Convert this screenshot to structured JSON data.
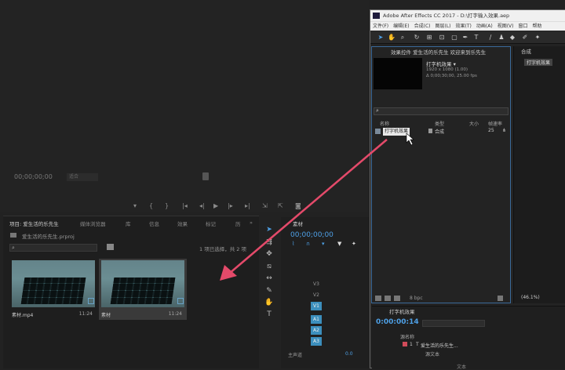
{
  "premiere": {
    "timecode": "00;00;00;00",
    "fit": "适合",
    "panel_tabs": [
      "项目: 爱生活的乐先生",
      "媒体浏览器",
      "库",
      "信息",
      "效果",
      "标记",
      "历"
    ],
    "project_file": "爱生活的乐先生.prproj",
    "selection": "1 项已选择，共 2 项",
    "clips": [
      {
        "name": "素材.mp4",
        "duration": "11:24"
      },
      {
        "name": "素材",
        "duration": "11:24"
      }
    ],
    "timeline_title": "素材",
    "timeline_time": "00;00;00;00",
    "tracks": [
      "V3",
      "V2",
      "V1",
      "A1",
      "A2",
      "A3"
    ],
    "master": "主声道",
    "master_value": "0.0"
  },
  "ae": {
    "window_title": "Adobe After Effects CC 2017 - D:\\打字输入效果.aep",
    "menu": [
      "文件(F)",
      "编辑(E)",
      "合成(C)",
      "图层(L)",
      "效果(T)",
      "动画(A)",
      "视图(V)",
      "窗口",
      "帮助"
    ],
    "project_tab": "效果控件 爱生活的乐先生  欢迎来到乐先生",
    "preview_name": "打字机效果 ▾",
    "preview_info_1": "1920 x 1080 (1.00)",
    "preview_info_2": "Δ 0;00;30;00, 25.00 fps",
    "columns": {
      "name": "名称",
      "type": "类型",
      "size": "大小",
      "fps": "帧速率"
    },
    "row": {
      "name": "打字机效果",
      "type": "合成",
      "fps": "25"
    },
    "bpc": "8 bpc",
    "comp_tab": "合成",
    "comp_chip": "打字机效果",
    "zoom": "(46.1%)",
    "timeline_tab": "打字机效果",
    "timeline_time": "0:00:00:14",
    "timeline_col": "源名称",
    "layer_name": "爱生活的乐先生...",
    "layer_index": "1",
    "source_text": "源文本",
    "text_prop": "文本"
  }
}
